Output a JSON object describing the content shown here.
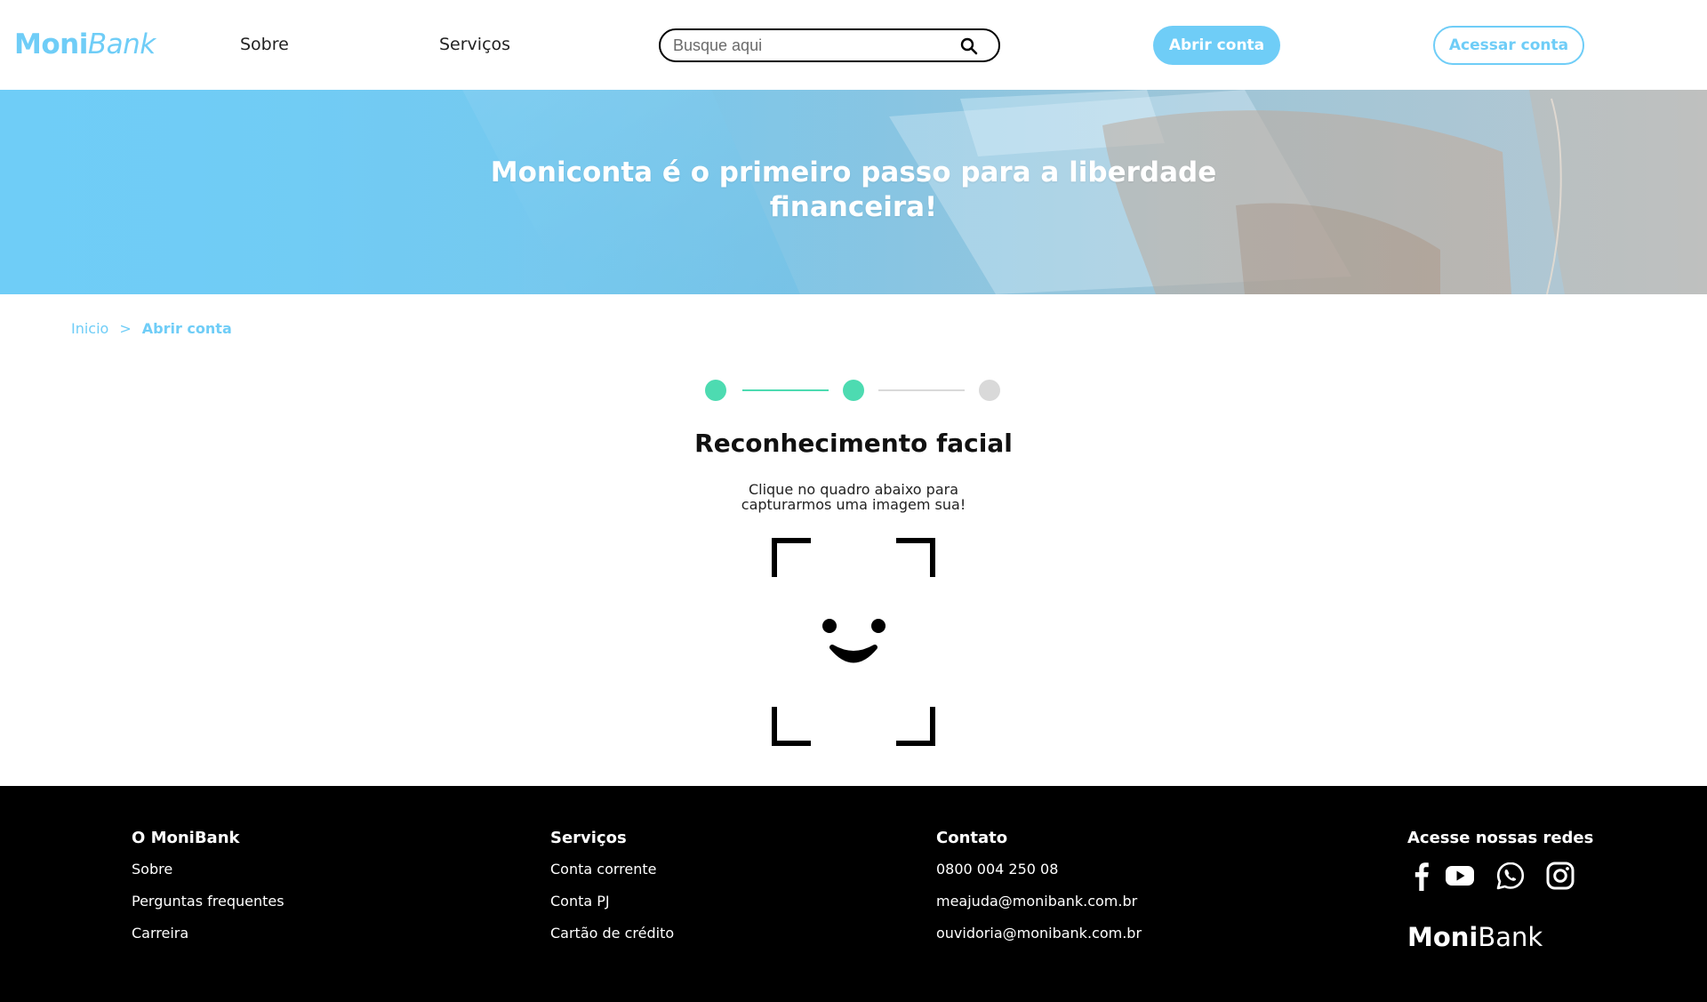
{
  "header": {
    "logo_bold": "Moni",
    "logo_light": "Bank",
    "nav": [
      {
        "label": "Sobre"
      },
      {
        "label": "Serviços"
      }
    ],
    "search": {
      "placeholder": "Busque aqui",
      "value": ""
    },
    "open_account_label": "Abrir conta",
    "access_account_label": "Acessar conta"
  },
  "hero": {
    "title": "Moniconta é o primeiro passo para a liberdade financeira!"
  },
  "breadcrumb": {
    "home": "Inicio",
    "separator": ">",
    "current": "Abrir conta"
  },
  "stepper": {
    "total_steps": 3,
    "completed_steps": 2,
    "active_color": "#4DDBB1",
    "inactive_color": "#D9D9D9"
  },
  "main": {
    "title": "Reconhecimento facial",
    "description_line1": "Clique no quadro abaixo para",
    "description_line2": "capturarmos uma imagem sua!"
  },
  "footer": {
    "columns": [
      {
        "heading": "O MoniBank",
        "links": [
          "Sobre",
          "Perguntas frequentes",
          "Carreira"
        ]
      },
      {
        "heading": "Serviços",
        "links": [
          "Conta corrente",
          "Conta PJ",
          "Cartão de crédito"
        ]
      },
      {
        "heading": "Contato",
        "links": [
          "0800 004 250 08",
          "meajuda@monibank.com.br",
          "ouvidoria@monibank.com.br"
        ]
      }
    ],
    "social_heading": "Acesse nossas redes",
    "socials": [
      "facebook-icon",
      "youtube-icon",
      "whatsapp-icon",
      "instagram-icon"
    ],
    "logo_bold": "Moni",
    "logo_light": "Bank"
  },
  "colors": {
    "brand": "#6FCDF7",
    "step_done": "#4DDBB1",
    "step_pending": "#D9D9D9",
    "footer_bg": "#000000"
  }
}
